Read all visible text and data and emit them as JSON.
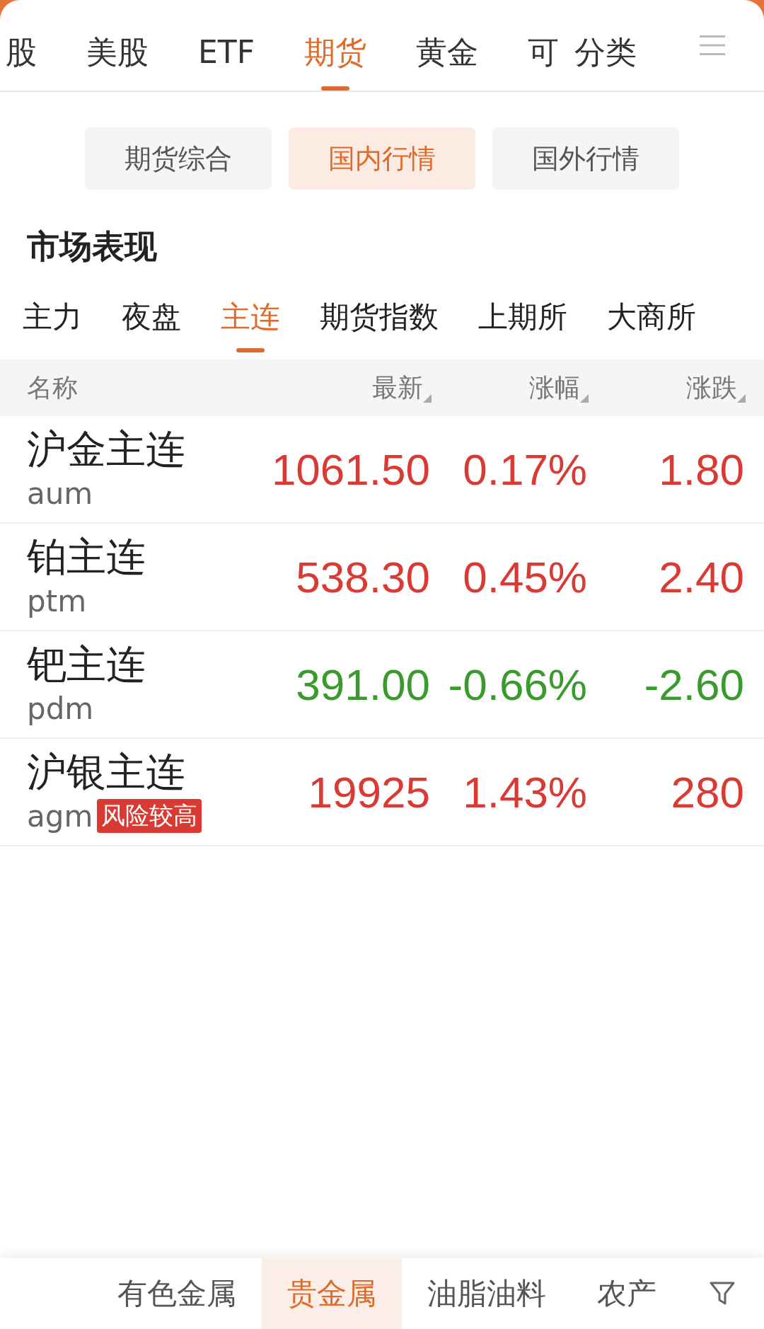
{
  "top_tabs": [
    {
      "label": "股",
      "selected": false
    },
    {
      "label": "美股",
      "selected": false
    },
    {
      "label": "ETF",
      "selected": false
    },
    {
      "label": "期货",
      "selected": true
    },
    {
      "label": "黄金",
      "selected": false
    },
    {
      "label": "可",
      "selected": false
    },
    {
      "label": "分类",
      "selected": false
    }
  ],
  "segments": [
    {
      "label": "期货综合",
      "selected": false
    },
    {
      "label": "国内行情",
      "selected": true
    },
    {
      "label": "国外行情",
      "selected": false
    }
  ],
  "section_title": "市场表现",
  "sub_tabs": [
    {
      "label": "主力",
      "selected": false
    },
    {
      "label": "夜盘",
      "selected": false
    },
    {
      "label": "主连",
      "selected": true
    },
    {
      "label": "期货指数",
      "selected": false
    },
    {
      "label": "上期所",
      "selected": false
    },
    {
      "label": "大商所",
      "selected": false
    }
  ],
  "table": {
    "columns": [
      "名称",
      "最新",
      "涨幅",
      "涨跌"
    ],
    "rows": [
      {
        "name": "沪金主连",
        "code": "aum",
        "latest": "1061.50",
        "pct": "0.17%",
        "change": "1.80",
        "color": "#d93a33"
      },
      {
        "name": "铂主连",
        "code": "ptm",
        "latest": "538.30",
        "pct": "0.45%",
        "change": "2.40",
        "color": "#d93a33"
      },
      {
        "name": "钯主连",
        "code": "pdm",
        "latest": "391.00",
        "pct": "-0.66%",
        "change": "-2.60",
        "color": "#3a9a2e"
      },
      {
        "name": "沪银主连",
        "code": "agm",
        "badge": "风险较高",
        "latest": "19925",
        "pct": "1.43%",
        "change": "280",
        "color": "#d93a33"
      }
    ]
  },
  "bottom_tabs": [
    {
      "label": "有色金属",
      "selected": false
    },
    {
      "label": "贵金属",
      "selected": true
    },
    {
      "label": "油脂油料",
      "selected": false
    },
    {
      "label": "农产",
      "selected": false
    }
  ]
}
